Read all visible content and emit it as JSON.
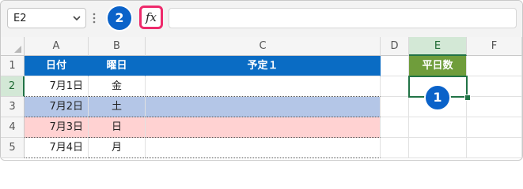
{
  "formula_bar": {
    "name_box_value": "E2",
    "fx_label": "fx",
    "formula_value": ""
  },
  "callouts": {
    "badge_1": "1",
    "badge_2": "2"
  },
  "columns": [
    "A",
    "B",
    "C",
    "D",
    "E",
    "F"
  ],
  "rows": [
    "1",
    "2",
    "3",
    "4",
    "5"
  ],
  "selected_column": "E",
  "selected_row": "2",
  "table": {
    "headers": [
      "日付",
      "曜日",
      "予定１"
    ],
    "data": [
      {
        "date": "7月1日",
        "weekday": "金",
        "plan": "",
        "style": "none"
      },
      {
        "date": "7月2日",
        "weekday": "土",
        "plan": "",
        "style": "blue"
      },
      {
        "date": "7月3日",
        "weekday": "日",
        "plan": "",
        "style": "pink"
      },
      {
        "date": "7月4日",
        "weekday": "月",
        "plan": "",
        "style": "none"
      }
    ]
  },
  "summary": {
    "header": "平日数",
    "value": ""
  },
  "colors": {
    "table_header_blue": "#0a6cc4",
    "summary_header_green": "#6f9d3b",
    "saturday_fill": "#b4c6e7",
    "sunday_fill": "#ffd2d2",
    "selection_green": "#217346",
    "badge_blue": "#0a62c9",
    "fx_highlight": "#ee2a6b"
  }
}
